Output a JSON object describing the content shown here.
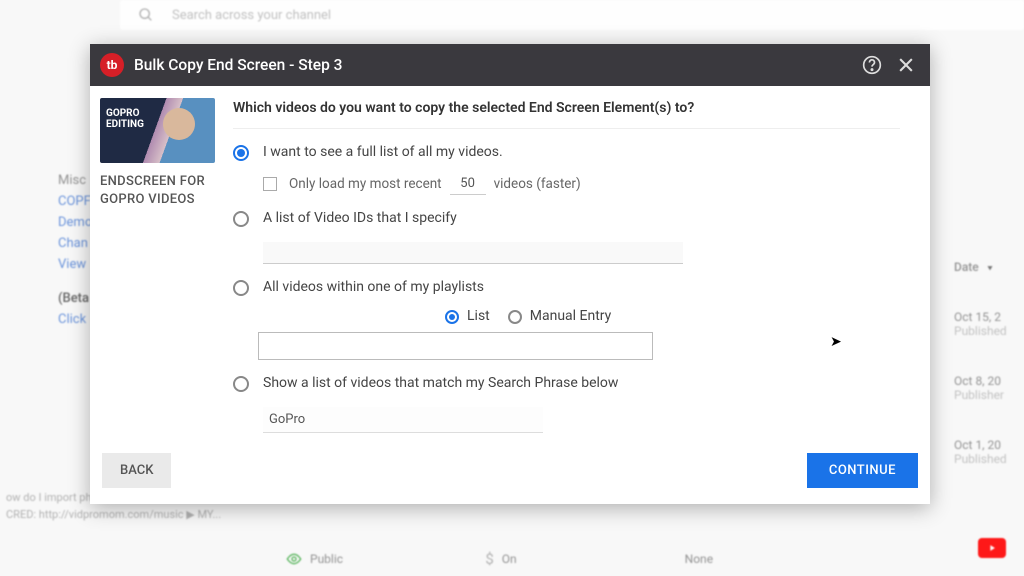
{
  "bg": {
    "search_placeholder": "Search across your channel",
    "left_items": [
      "Misc",
      "COPF",
      "Demo",
      "Chan",
      "View"
    ],
    "left_section": "(Beta",
    "left_sub": "Click",
    "date_header": "Date",
    "rows": [
      {
        "date": "Oct 15, 2",
        "status": "Published"
      },
      {
        "date": "Oct 8, 20",
        "status": "Publisher"
      },
      {
        "date": "Oct 1, 20",
        "status": "Published"
      }
    ],
    "bottom_line1": "ow do I import photos to GoPro Studio?   or  how",
    "bottom_line2": "CRED: http://vidpromom.com/music  ▶  MY...",
    "bottom_line3": "",
    "visibility": "Public",
    "mon": "On",
    "restrict": "None"
  },
  "modal": {
    "title": "Bulk Copy End Screen - Step 3",
    "logo": "tb",
    "sidebar_title": "ENDSCREEN FOR GOPRO VIDEOS",
    "question": "Which videos do you want to copy the selected End Screen Element(s) to?",
    "opt1": "I want to see a full list of all my videos.",
    "opt1_sub_a": "Only load my most recent",
    "opt1_sub_count": "50",
    "opt1_sub_b": "videos (faster)",
    "opt2": "A list of Video IDs that I specify",
    "opt3": "All videos within one of my playlists",
    "opt3_list": "List",
    "opt3_manual": "Manual Entry",
    "opt4": "Show a list of videos that match my Search Phrase below",
    "opt4_value": "GoPro",
    "back": "BACK",
    "continue": "CONTINUE"
  }
}
